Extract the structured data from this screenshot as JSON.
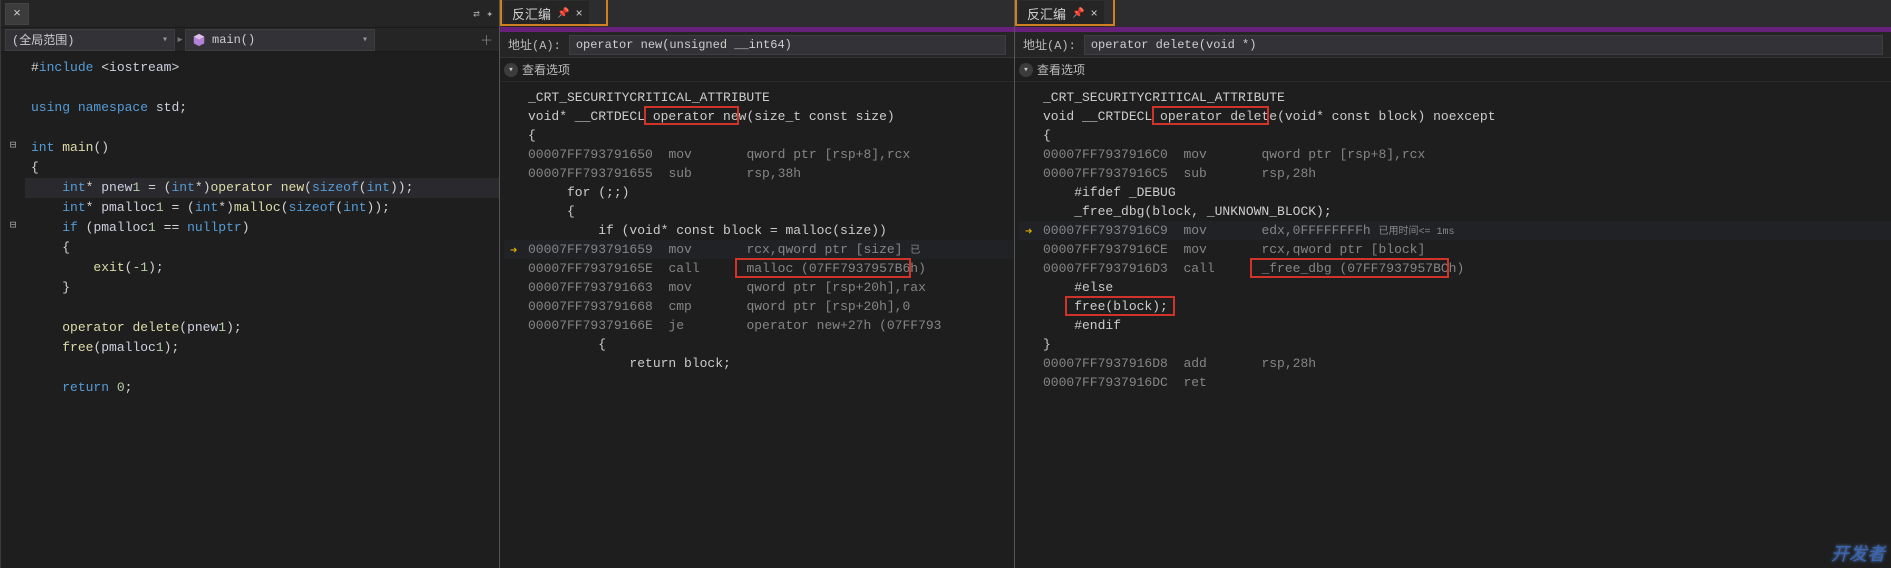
{
  "src_panel": {
    "close": "×",
    "scope_label": "(全局范围)",
    "func_label": "main()",
    "code": [
      {
        "fold": "",
        "t": "#include <iostream>",
        "cls": "inc"
      },
      {
        "fold": "",
        "t": "",
        "cls": "blank"
      },
      {
        "fold": "",
        "t": "using namespace std;",
        "cls": "kw-line"
      },
      {
        "fold": "",
        "t": "",
        "cls": "blank"
      },
      {
        "fold": "⊟",
        "t": "int main()",
        "cls": "fn"
      },
      {
        "fold": "",
        "t": "{",
        "cls": "punct"
      },
      {
        "fold": "",
        "t": "    int* pnew1 = (int*)operator new(sizeof(int));",
        "cls": "cur"
      },
      {
        "fold": "",
        "t": "    int* pmalloc1 = (int*)malloc(sizeof(int));",
        "cls": "mid"
      },
      {
        "fold": "⊟",
        "t": "    if (pmalloc1 == nullptr)",
        "cls": "mid"
      },
      {
        "fold": "",
        "t": "    {",
        "cls": "punct"
      },
      {
        "fold": "",
        "t": "        exit(-1);",
        "cls": "mid"
      },
      {
        "fold": "",
        "t": "    }",
        "cls": "punct"
      },
      {
        "fold": "",
        "t": "",
        "cls": "blank"
      },
      {
        "fold": "",
        "t": "    operator delete(pnew1);",
        "cls": "mid"
      },
      {
        "fold": "",
        "t": "    free(pmalloc1);",
        "cls": "mid"
      },
      {
        "fold": "",
        "t": "",
        "cls": "blank"
      },
      {
        "fold": "",
        "t": "    return 0;",
        "cls": "mid"
      }
    ]
  },
  "disasm1": {
    "tab_title": "反汇编",
    "addr_label": "地址(A):",
    "addr_value": "operator new(unsigned __int64)",
    "opt_label": "查看选项",
    "attr": "_CRT_SECURITYCRITICAL_ATTRIBUTE",
    "sig_pre": "void* __CRTDECL ",
    "sig_hi": "operator new",
    "sig_post": "(size_t const size)",
    "lines": [
      {
        "arrow": false,
        "addr": "00007FF793791650",
        "mnem": "mov",
        "op": "qword ptr [rsp+8],rcx"
      },
      {
        "arrow": false,
        "addr": "00007FF793791655",
        "mnem": "sub",
        "op": "rsp,38h"
      },
      {
        "arrow": false,
        "raw": "     for (;;)"
      },
      {
        "arrow": false,
        "raw": "     {"
      },
      {
        "arrow": false,
        "raw": "         if (void* const block = malloc(size))"
      },
      {
        "arrow": true,
        "addr": "00007FF793791659",
        "mnem": "mov",
        "op": "rcx,qword ptr [size]",
        "timing": "已"
      },
      {
        "arrow": false,
        "addr": "00007FF79379165E",
        "mnem": "call",
        "op": "malloc (07FF7937957B6h)",
        "red": true
      },
      {
        "arrow": false,
        "addr": "00007FF793791663",
        "mnem": "mov",
        "op": "qword ptr [rsp+20h],rax"
      },
      {
        "arrow": false,
        "addr": "00007FF793791668",
        "mnem": "cmp",
        "op": "qword ptr [rsp+20h],0"
      },
      {
        "arrow": false,
        "addr": "00007FF79379166E",
        "mnem": "je",
        "op": "operator new+27h (07FF793"
      },
      {
        "arrow": false,
        "raw": "         {"
      },
      {
        "arrow": false,
        "raw": "             return block;"
      }
    ]
  },
  "disasm2": {
    "tab_title": "反汇编",
    "addr_label": "地址(A):",
    "addr_value": "operator delete(void *)",
    "opt_label": "查看选项",
    "attr": "_CRT_SECURITYCRITICAL_ATTRIBUTE",
    "sig_pre": "void __CRTDECL ",
    "sig_hi": "operator delete",
    "sig_post": "(void* const block) noexcept",
    "open_brace": "{",
    "lines": [
      {
        "arrow": false,
        "addr": "00007FF7937916C0",
        "mnem": "mov",
        "op": "qword ptr [rsp+8],rcx"
      },
      {
        "arrow": false,
        "addr": "00007FF7937916C5",
        "mnem": "sub",
        "op": "rsp,28h"
      },
      {
        "arrow": false,
        "raw": "    #ifdef _DEBUG"
      },
      {
        "arrow": false,
        "raw": "    _free_dbg(block, _UNKNOWN_BLOCK);"
      },
      {
        "arrow": true,
        "addr": "00007FF7937916C9",
        "mnem": "mov",
        "op": "edx,0FFFFFFFFh",
        "timing": "已用时间<= 1ms"
      },
      {
        "arrow": false,
        "addr": "00007FF7937916CE",
        "mnem": "mov",
        "op": "rcx,qword ptr [block]"
      },
      {
        "arrow": false,
        "addr": "00007FF7937916D3",
        "mnem": "call",
        "op": "_free_dbg (07FF7937957BCh)",
        "red": true
      },
      {
        "arrow": false,
        "raw": "    #else",
        "red2": false
      },
      {
        "arrow": false,
        "raw": "    free(block);",
        "red2": true
      },
      {
        "arrow": false,
        "raw": "    #endif"
      },
      {
        "arrow": false,
        "raw": "}"
      },
      {
        "arrow": false,
        "addr": "00007FF7937916D8",
        "mnem": "add",
        "op": "rsp,28h"
      },
      {
        "arrow": false,
        "addr": "00007FF7937916DC",
        "mnem": "ret",
        "op": ""
      }
    ]
  },
  "watermark": "开发者"
}
